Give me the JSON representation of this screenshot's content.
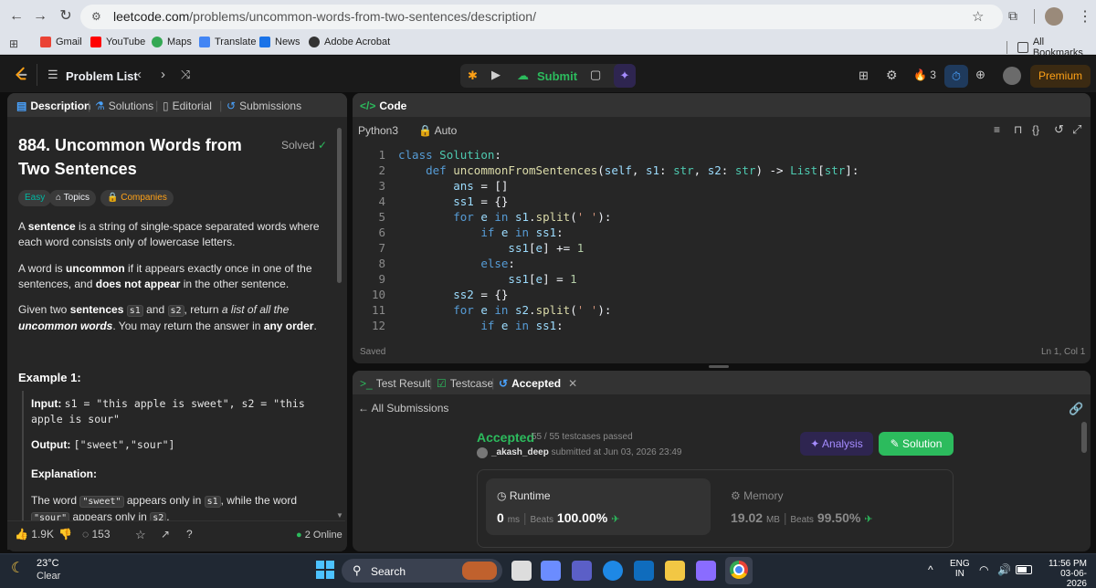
{
  "browser": {
    "url_host": "leetcode.com",
    "url_path": "/problems/uncommon-words-from-two-sentences/description/",
    "bookmarks": [
      "Gmail",
      "YouTube",
      "Maps",
      "Translate",
      "News",
      "Adobe Acrobat"
    ],
    "all_bookmarks": "All Bookmarks"
  },
  "navbar": {
    "problem_list": "Problem List",
    "submit": "Submit",
    "streak": "3",
    "premium": "Premium"
  },
  "left_panel": {
    "tabs": [
      "Description",
      "Solutions",
      "Editorial",
      "Submissions"
    ],
    "title": "884. Uncommon Words from Two Sentences",
    "solved": "Solved",
    "difficulty": "Easy",
    "topics": "Topics",
    "companies": "Companies",
    "p1_a": "A ",
    "p1_b": "sentence",
    "p1_c": " is a string of single-space separated words where each word consists only of lowercase letters.",
    "p2_a": "A word is ",
    "p2_b": "uncommon",
    "p2_c": " if it appears exactly once in one of the sentences, and ",
    "p2_d": "does not appear",
    "p2_e": " in the other sentence.",
    "p3_a": "Given two ",
    "p3_b": "sentences",
    "p3_s1": "s1",
    "p3_and": " and ",
    "p3_s2": "s2",
    "p3_c": ", return ",
    "p3_d": "a list of all the ",
    "p3_e": "uncommon words",
    "p3_f": ". You may return the answer in ",
    "p3_g": "any order",
    "p3_h": ".",
    "example_title": "Example 1:",
    "input_label": "Input:",
    "input_value": "s1 = \"this apple is sweet\", s2 = \"this apple is sour\"",
    "output_label": "Output:",
    "output_value": "[\"sweet\",\"sour\"]",
    "explanation_label": "Explanation:",
    "expl_a": "The word ",
    "expl_sweet": "\"sweet\"",
    "expl_b": " appears only in ",
    "expl_s1": "s1",
    "expl_c": ", while the word ",
    "expl_sour": "\"sour\"",
    "expl_d": " appears only in ",
    "expl_s2": "s2",
    "expl_e": ".",
    "likes": "1.9K",
    "comments": "153",
    "online": "2 Online"
  },
  "editor": {
    "tab": "Code",
    "language": "Python3",
    "mode": "Auto",
    "status": "Saved",
    "cursor": "Ln 1, Col 1",
    "lines": [
      "class Solution:",
      "    def uncommonFromSentences(self, s1: str, s2: str) -> List[str]:",
      "        ans = []",
      "        ss1 = {}",
      "        for e in s1.split(' '):",
      "            if e in ss1:",
      "                ss1[e] += 1",
      "            else:",
      "                ss1[e] = 1",
      "        ss2 = {}",
      "        for e in s2.split(' '):",
      "            if e in ss1:"
    ]
  },
  "results": {
    "tabs": [
      "Test Result",
      "Testcase",
      "Accepted"
    ],
    "back": "All Submissions",
    "status": "Accepted",
    "passed": "55 / 55 testcases passed",
    "user": "_akash_deep",
    "submitted": "submitted at Jun 03, 2026 23:49",
    "analysis": "Analysis",
    "solution": "Solution",
    "runtime_label": "Runtime",
    "runtime_value": "0",
    "runtime_unit": "ms",
    "beats_label": "Beats",
    "runtime_beats": "100.00%",
    "memory_label": "Memory",
    "memory_value": "19.02",
    "memory_unit": "MB",
    "memory_beats": "99.50%"
  },
  "taskbar": {
    "temp": "23°C",
    "weather": "Clear",
    "search": "Search",
    "lang1": "ENG",
    "lang2": "IN",
    "time": "11:56 PM",
    "date": "03-06-2026"
  }
}
